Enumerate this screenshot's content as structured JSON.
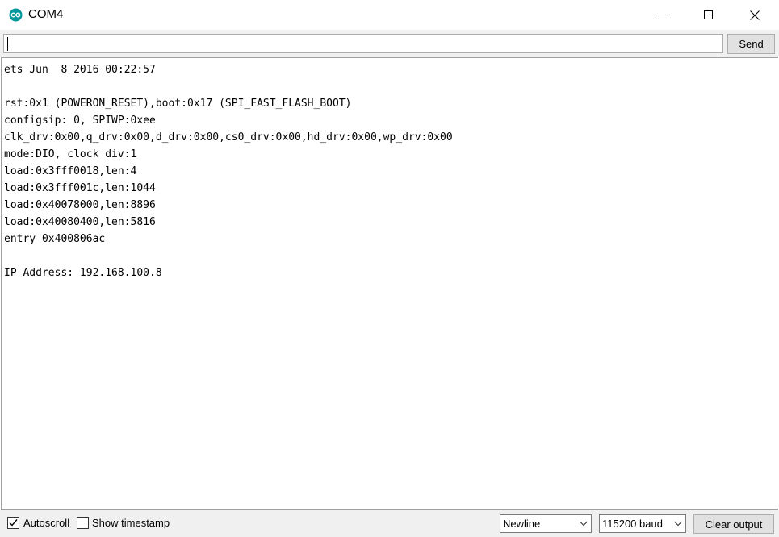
{
  "window": {
    "title": "COM4",
    "icon": "arduino-logo-icon",
    "accent_color": "#00979c"
  },
  "input": {
    "value": "",
    "send_label": "Send"
  },
  "output": {
    "lines": [
      "ets Jun  8 2016 00:22:57",
      "",
      "rst:0x1 (POWERON_RESET),boot:0x17 (SPI_FAST_FLASH_BOOT)",
      "configsip: 0, SPIWP:0xee",
      "clk_drv:0x00,q_drv:0x00,d_drv:0x00,cs0_drv:0x00,hd_drv:0x00,wp_drv:0x00",
      "mode:DIO, clock div:1",
      "load:0x3fff0018,len:4",
      "load:0x3fff001c,len:1044",
      "load:0x40078000,len:8896",
      "load:0x40080400,len:5816",
      "entry 0x400806ac",
      "",
      "IP Address: 192.168.100.8"
    ]
  },
  "footer": {
    "autoscroll_label": "Autoscroll",
    "autoscroll_checked": true,
    "timestamp_label": "Show timestamp",
    "timestamp_checked": false,
    "line_ending": "Newline",
    "baud_rate": "115200 baud",
    "clear_label": "Clear output"
  }
}
